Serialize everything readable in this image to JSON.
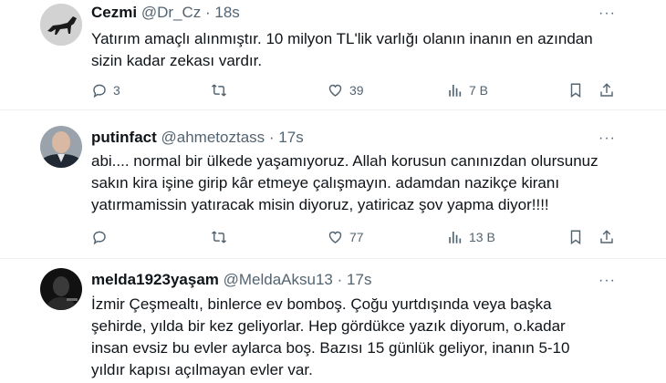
{
  "tweets": [
    {
      "display_name": "Cezmi",
      "handle": "@Dr_Cz",
      "time": "18s",
      "text": "Yatırım amaçlı alınmıştır. 10 milyon TL'lik varlığı olanın inanın en azından sizin kadar zekası vardır.",
      "replies": "3",
      "reposts": "",
      "likes": "39",
      "views": "7 B"
    },
    {
      "display_name": "putinfact",
      "handle": "@ahmetoztass",
      "time": "17s",
      "text": "abi.... normal bir ülkede yaşamıyoruz. Allah korusun canınızdan olursunuz sakın kira işine girip kâr etmeye çalışmayın. adamdan nazikçe kiranı yatırmamissin yatıracak misin diyoruz, yatiricaz şov yapma diyor!!!!",
      "replies": "",
      "reposts": "",
      "likes": "77",
      "views": "13 B"
    },
    {
      "display_name": "melda1923yaşam",
      "handle": "@MeldaAksu13",
      "time": "17s",
      "text": "İzmir Çeşmealtı, binlerce ev bomboş. Çoğu yurtdışında veya başka şehirde, yılda bir kez geliyorlar. Hep gördükce yazık diyorum, o.kadar insan evsiz bu evler aylarca boş. Bazısı 15 günlük geliyor, inanın 5-10 yıldır kapısı açılmayan evler var."
    }
  ],
  "separator": "·",
  "more_glyph": "···",
  "icons": [
    "reply-icon",
    "repost-icon",
    "like-icon",
    "views-icon",
    "bookmark-icon",
    "share-icon",
    "more-icon"
  ],
  "colors": {
    "text": "#0f1419",
    "secondary": "#536471",
    "border": "#eff3f4"
  }
}
